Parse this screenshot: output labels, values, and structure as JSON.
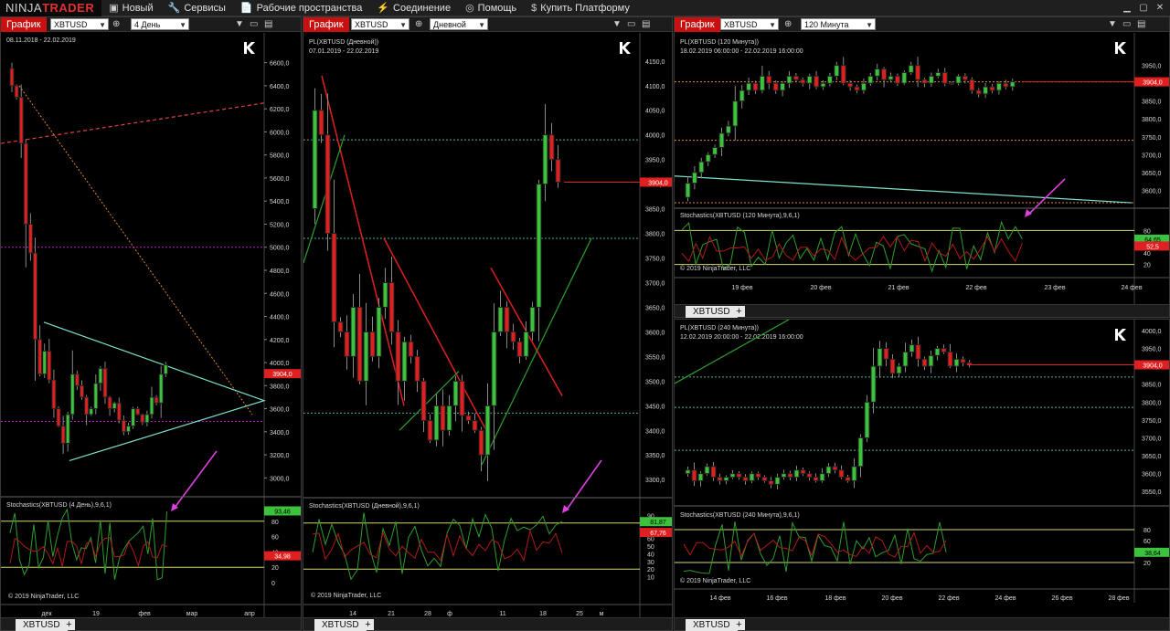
{
  "app": {
    "logo_a": "NINJA",
    "logo_b": "TRADER",
    "menu": [
      {
        "icon": "square-icon",
        "glyph": "▣",
        "label": "Новый"
      },
      {
        "icon": "wrench-icon",
        "glyph": "🔧",
        "label": "Сервисы"
      },
      {
        "icon": "document-icon",
        "glyph": "📄",
        "label": "Рабочие пространства"
      },
      {
        "icon": "plug-icon",
        "glyph": "⚡",
        "label": "Соединение"
      },
      {
        "icon": "help-icon",
        "glyph": "◎",
        "label": "Помощь"
      },
      {
        "icon": "dollar-icon",
        "glyph": "$",
        "label": "Купить Платформу"
      }
    ]
  },
  "panels": {
    "p1": {
      "chart_label": "График",
      "instrument": "XBTUSD",
      "interval": "4 День",
      "title": "",
      "range": "08.11.2018 - 22.02.2019",
      "osc_label": "Stochastics(XBTUSD (4 День),9,6,1)",
      "copyright": "© 2019 NinjaTrader, LLC",
      "tab": "XBTUSD",
      "price_labels": [
        "6600,0",
        "6400,0",
        "6200,0",
        "6000,0",
        "5800,0",
        "5600,0",
        "5400,0",
        "5200,0",
        "5000,0",
        "4800,0",
        "4600,0",
        "4400,0",
        "4200,0",
        "4000,0",
        "3800,0",
        "3600,0",
        "3400,0",
        "3200,0",
        "3000,0"
      ],
      "last_price": "3904,0",
      "osc_labels": [
        "80",
        "60",
        "40",
        "20",
        "0"
      ],
      "osc_k": "93,46",
      "osc_d": "34,98",
      "dates": [
        "дек",
        "19",
        "фев",
        "мар",
        "апр"
      ]
    },
    "p2": {
      "chart_label": "График",
      "instrument": "XBTUSD",
      "interval": "Дневной",
      "title": "PL(XBTUSD (Дневной))",
      "range": "07.01.2019 - 22.02.2019",
      "osc_label": "Stochastics(XBTUSD (Дневной),9,6,1)",
      "copyright": "© 2019 NinjaTrader, LLC",
      "tab": "XBTUSD",
      "price_labels": [
        "4150,0",
        "4100,0",
        "4050,0",
        "4000,0",
        "3950,0",
        "3900,0",
        "3850,0",
        "3800,0",
        "3750,0",
        "3700,0",
        "3650,0",
        "3600,0",
        "3550,0",
        "3500,0",
        "3450,0",
        "3400,0",
        "3350,0",
        "3300,0"
      ],
      "last_price": "3904,0",
      "osc_labels": [
        "90",
        "80",
        "70",
        "60",
        "50",
        "40",
        "30",
        "20",
        "10"
      ],
      "osc_k": "81,87",
      "osc_d": "67,76",
      "dates": [
        "14",
        "21",
        "28",
        "ф",
        "11",
        "18",
        "25",
        "м"
      ]
    },
    "p3": {
      "chart_label": "График",
      "instrument": "XBTUSD",
      "interval": "120 Минута",
      "title": "PL(XBTUSD (120 Минута))",
      "range": "18.02.2019 06:00:00 - 22.02.2019 16:00:00",
      "osc_label": "Stochastics(XBTUSD (120 Минута),9,6,1)",
      "copyright": "© 2019 NinjaTrader, LLC",
      "tab": "XBTUSD",
      "price_labels": [
        "3950,0",
        "3900,0",
        "3850,0",
        "3800,0",
        "3750,0",
        "3700,0",
        "3650,0",
        "3600,0"
      ],
      "last_price": "3904,0",
      "osc_labels": [
        "80",
        "60",
        "40",
        "20"
      ],
      "osc_k": "64,65",
      "osc_d": "52,5",
      "dates": [
        "19 фев",
        "20 фев",
        "21 фев",
        "22 фев",
        "23 фев",
        "24 фев"
      ]
    },
    "p4": {
      "title": "PL(XBTUSD (240 Минута))",
      "range": "12.02.2019 20:00:00 - 22.02.2019 16:00:00",
      "osc_label": "Stochastics(XBTUSD (240 Минута),9,6,1)",
      "copyright": "© 2019 NinjaTrader, LLC",
      "price_labels": [
        "4000,0",
        "3950,0",
        "3900,0",
        "3850,0",
        "3800,0",
        "3750,0",
        "3700,0",
        "3650,0",
        "3600,0",
        "3550,0"
      ],
      "last_price": "3904,0",
      "osc_labels": [
        "80",
        "60",
        "40",
        "20"
      ],
      "osc_k": "38,64",
      "dates": [
        "14 фев",
        "16 фев",
        "18 фев",
        "20 фев",
        "22 фев",
        "24 фев",
        "26 фев",
        "28 фев"
      ]
    }
  },
  "colors": {
    "bull": "#3cc23c",
    "bear": "#e02020",
    "accent_red": "#c81010",
    "osc_k": "#2e9e2e",
    "osc_d": "#b01a1a",
    "level_line": "#d8d870",
    "orange_dotted": "#e08a2a",
    "teal_dotted": "#4ab0a0",
    "magenta_dotted": "#c020c0",
    "arrow": "#e040e0"
  }
}
